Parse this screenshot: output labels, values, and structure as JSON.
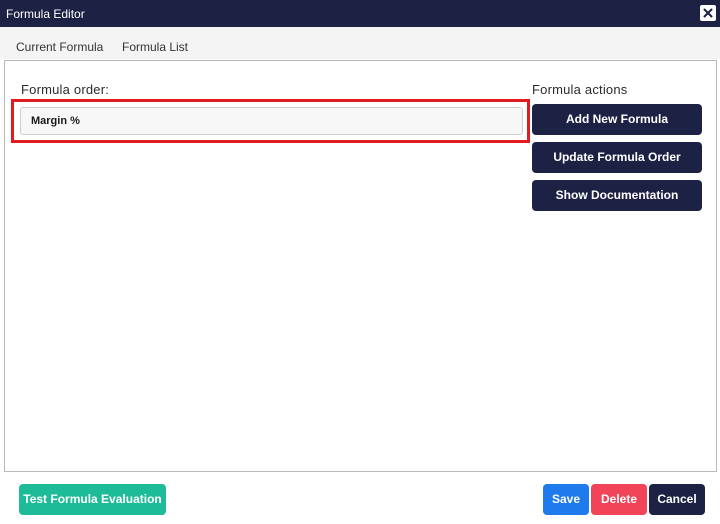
{
  "window": {
    "title": "Formula Editor",
    "close_icon": "close-icon"
  },
  "tabs": [
    {
      "label": "Current Formula"
    },
    {
      "label": "Formula List"
    }
  ],
  "order_panel": {
    "label": "Formula order:",
    "items": [
      {
        "label": "Margin %"
      }
    ]
  },
  "actions_panel": {
    "label": "Formula actions",
    "buttons": [
      {
        "label": "Add New Formula"
      },
      {
        "label": "Update Formula Order"
      },
      {
        "label": "Show Documentation"
      }
    ]
  },
  "footer": {
    "test_label": "Test Formula Evaluation",
    "save_label": "Save",
    "delete_label": "Delete",
    "cancel_label": "Cancel"
  },
  "colors": {
    "titlebar": "#1d2245",
    "primary_dark": "#1d2245",
    "highlight_border": "#e01b22",
    "test_button": "#1dbb97",
    "save_button": "#1f7bec",
    "delete_button": "#f14458"
  }
}
